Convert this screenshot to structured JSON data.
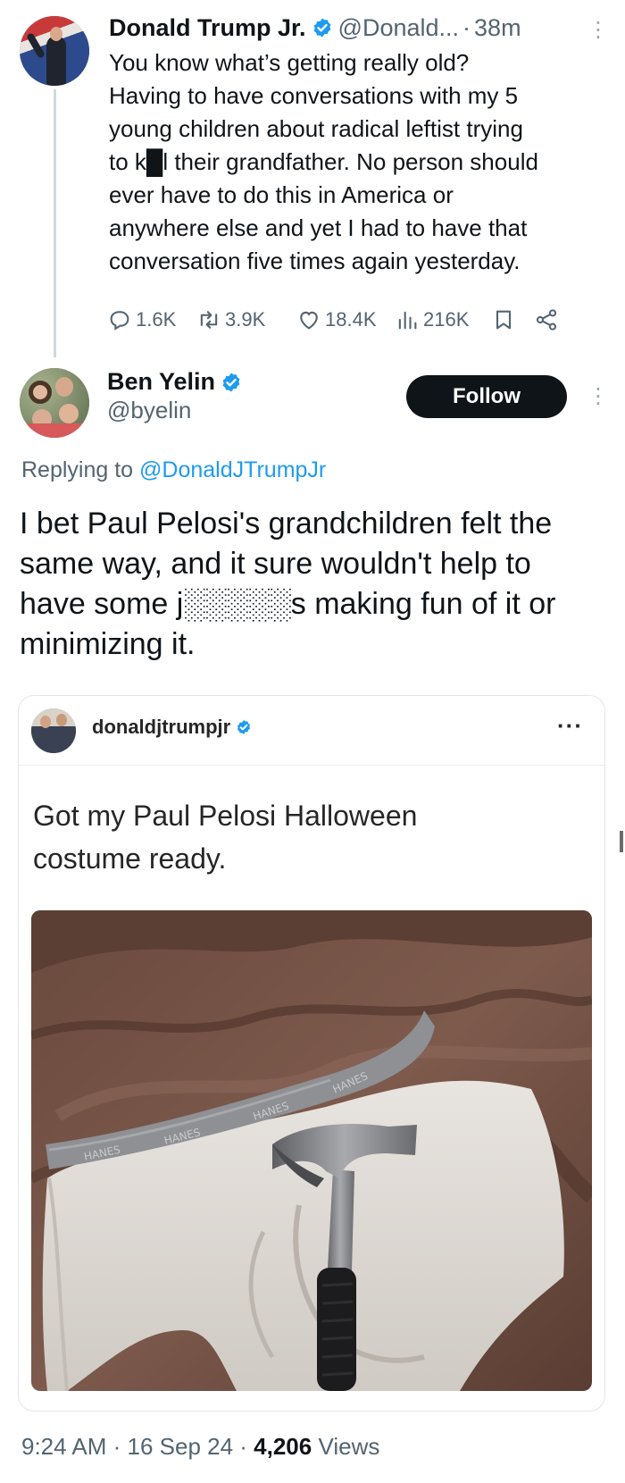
{
  "parent_tweet": {
    "author_name": "Donald Trump Jr.",
    "handle": "@Donald...",
    "separator": "·",
    "time": "38m",
    "text": "You know what’s getting really old?\nHaving to have conversations with my 5\nyoung children about radical leftist trying\nto k█l their grandfather. No person should\never have to do this in America or\nanywhere else and yet I had to have that\nconversation five times again yesterday.",
    "stats": {
      "replies": "1.6K",
      "reposts": "3.9K",
      "likes": "18.4K",
      "views": "216K"
    }
  },
  "reply_tweet": {
    "author_name": "Ben Yelin",
    "handle": "@byelin",
    "follow_label": "Follow",
    "replying_prefix": "Replying to ",
    "replying_to": "@DonaldJTrumpJr",
    "text": "I bet Paul Pelosi's grandchildren felt the\nsame way, and it sure wouldn't help to\nhave some j░░░░░s making fun of it or\nminimizing it.",
    "timestamp": "9:24 AM · 16 Sep 24 · ",
    "views_count": "4,206",
    "views_label": " Views"
  },
  "quoted_post": {
    "username": "donaldjtrumpjr",
    "more": "···",
    "text": "Got my Paul Pelosi Halloween\ncostume ready.",
    "waistband_text": "HANES"
  },
  "colors": {
    "accent_blue": "#1d9bf0",
    "text_primary": "#0f1419",
    "text_secondary": "#536471",
    "follow_button_bg": "#0f1419"
  },
  "icons": [
    "verified-badge-icon",
    "reply-icon",
    "repost-icon",
    "like-icon",
    "views-icon",
    "bookmark-icon",
    "share-icon",
    "more-icon"
  ]
}
